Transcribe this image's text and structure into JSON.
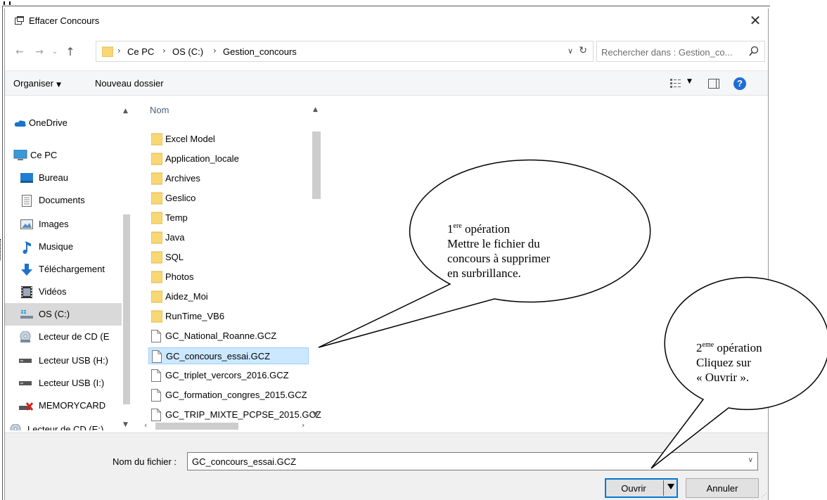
{
  "window": {
    "title": "Effacer Concours",
    "close_glyph": "✕"
  },
  "address": {
    "breadcrumbs": [
      "Ce PC",
      "OS (C:)",
      "Gestion_concours"
    ],
    "search_placeholder": "Rechercher dans : Gestion_co..."
  },
  "toolbar": {
    "organize_label": "Organiser",
    "new_folder_label": "Nouveau dossier",
    "help_glyph": "?"
  },
  "nav": {
    "items": [
      {
        "label": "OneDrive",
        "icon": "onedrive-icon"
      },
      {
        "label": "Ce PC",
        "icon": "computer-icon"
      },
      {
        "label": "Bureau",
        "icon": "desktop-icon"
      },
      {
        "label": "Documents",
        "icon": "documents-icon"
      },
      {
        "label": "Images",
        "icon": "images-icon"
      },
      {
        "label": "Musique",
        "icon": "music-icon"
      },
      {
        "label": "Téléchargement",
        "icon": "download-icon"
      },
      {
        "label": "Vidéos",
        "icon": "videos-icon"
      },
      {
        "label": "OS (C:)",
        "icon": "drive-icon"
      },
      {
        "label": "Lecteur de CD (E",
        "icon": "cd-drive-icon"
      },
      {
        "label": "Lecteur USB (H:)",
        "icon": "usb-drive-icon"
      },
      {
        "label": "Lecteur USB (I:)",
        "icon": "usb-drive-icon"
      },
      {
        "label": "MEMORYCARD",
        "icon": "memory-card-icon"
      },
      {
        "label": "Lecteur de CD (E:)",
        "icon": "cd-drive-icon"
      }
    ],
    "selected": "OS (C:)"
  },
  "files": {
    "column_header": "Nom",
    "items": [
      {
        "name": "Excel Model",
        "type": "folder"
      },
      {
        "name": "Application_locale",
        "type": "folder"
      },
      {
        "name": "Archives",
        "type": "folder"
      },
      {
        "name": "Geslico",
        "type": "folder"
      },
      {
        "name": "Temp",
        "type": "folder"
      },
      {
        "name": "Java",
        "type": "folder"
      },
      {
        "name": "SQL",
        "type": "folder"
      },
      {
        "name": "Photos",
        "type": "folder"
      },
      {
        "name": "Aidez_Moi",
        "type": "folder"
      },
      {
        "name": "RunTime_VB6",
        "type": "folder"
      },
      {
        "name": "GC_National_Roanne.GCZ",
        "type": "file"
      },
      {
        "name": "GC_concours_essai.GCZ",
        "type": "file"
      },
      {
        "name": "GC_triplet_vercors_2016.GCZ",
        "type": "file"
      },
      {
        "name": "GC_formation_congres_2015.GCZ",
        "type": "file"
      },
      {
        "name": "GC_TRIP_MIXTE_PCPSE_2015.GCZ",
        "type": "file"
      }
    ],
    "selected": "GC_concours_essai.GCZ"
  },
  "bottom": {
    "filename_label": "Nom du fichier :",
    "filename_value": "GC_concours_essai.GCZ",
    "open_label": "Ouvrir",
    "cancel_label": "Annuler"
  },
  "callouts": [
    {
      "ordinal": "1",
      "ordinal_sup": "ere",
      "heading_rest": " opération",
      "lines": [
        "Mettre le fichier du",
        "concours à supprimer",
        "en surbrillance."
      ]
    },
    {
      "ordinal": "2",
      "ordinal_sup": "eme",
      "heading_rest": " opération",
      "lines": [
        "Cliquez sur",
        "« Ouvrir »."
      ]
    }
  ],
  "colors": {
    "accent": "#0078d7",
    "selection": "#cce8ff",
    "folder": "#f8d775",
    "toolbar_bg": "#f5f6f7",
    "bottom_bg": "#f0f0f0"
  }
}
